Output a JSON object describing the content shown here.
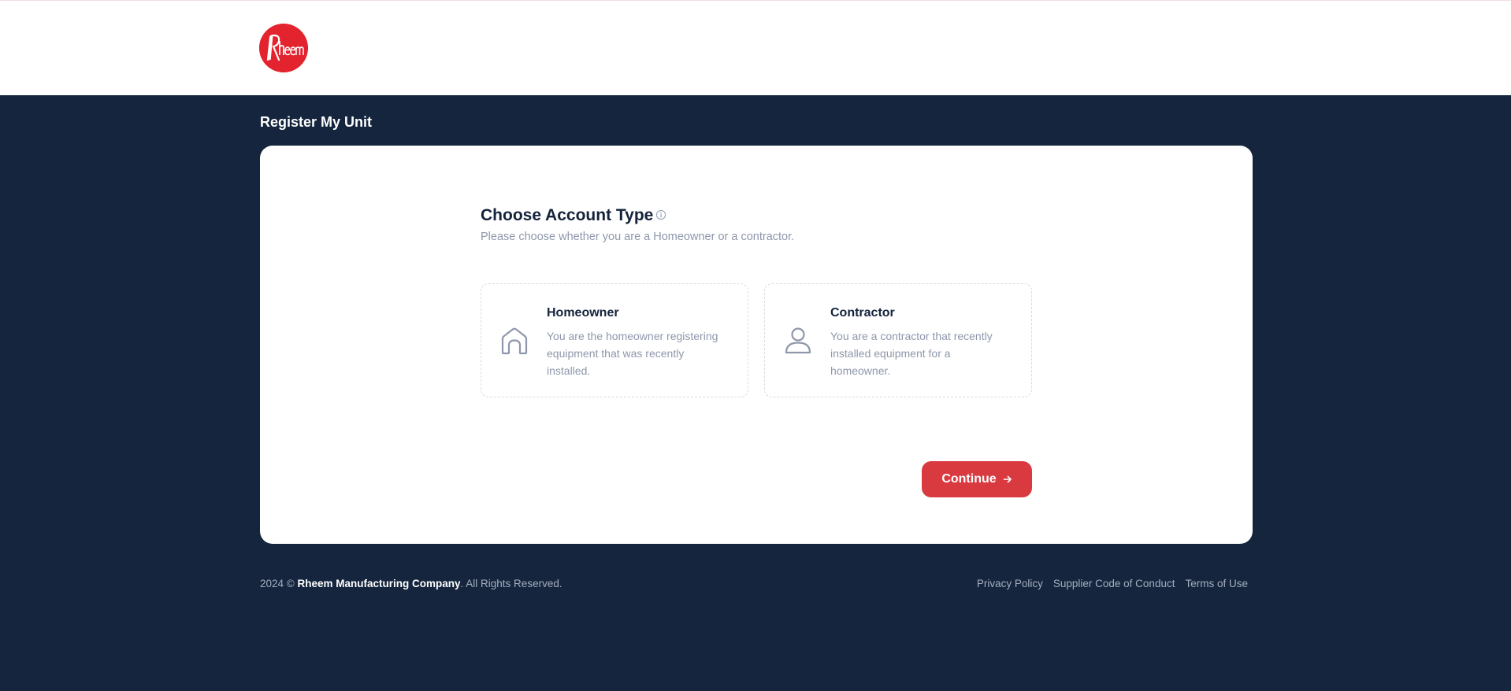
{
  "brand": {
    "logo_text": "Rheem",
    "logo_color": "#e3242f"
  },
  "page": {
    "title": "Register My Unit"
  },
  "account_type": {
    "title": "Choose Account Type",
    "subtitle": "Please choose whether you are a Homeowner or a contractor.",
    "options": [
      {
        "icon": "house-icon",
        "title": "Homeowner",
        "description": "You are the homeowner registering equipment that was recently installed."
      },
      {
        "icon": "user-icon",
        "title": "Contractor",
        "description": "You are a contractor that recently installed equipment for a homeowner."
      }
    ],
    "continue_label": "Continue"
  },
  "footer": {
    "year_prefix": "2024 ©",
    "company": "Rheem Manufacturing Company",
    "rights": ". All Rights Reserved.",
    "links": [
      "Privacy Policy",
      "Supplier Code of Conduct",
      "Terms of Use"
    ]
  },
  "colors": {
    "background": "#14253d",
    "accent": "#d93a40",
    "card": "#ffffff"
  }
}
